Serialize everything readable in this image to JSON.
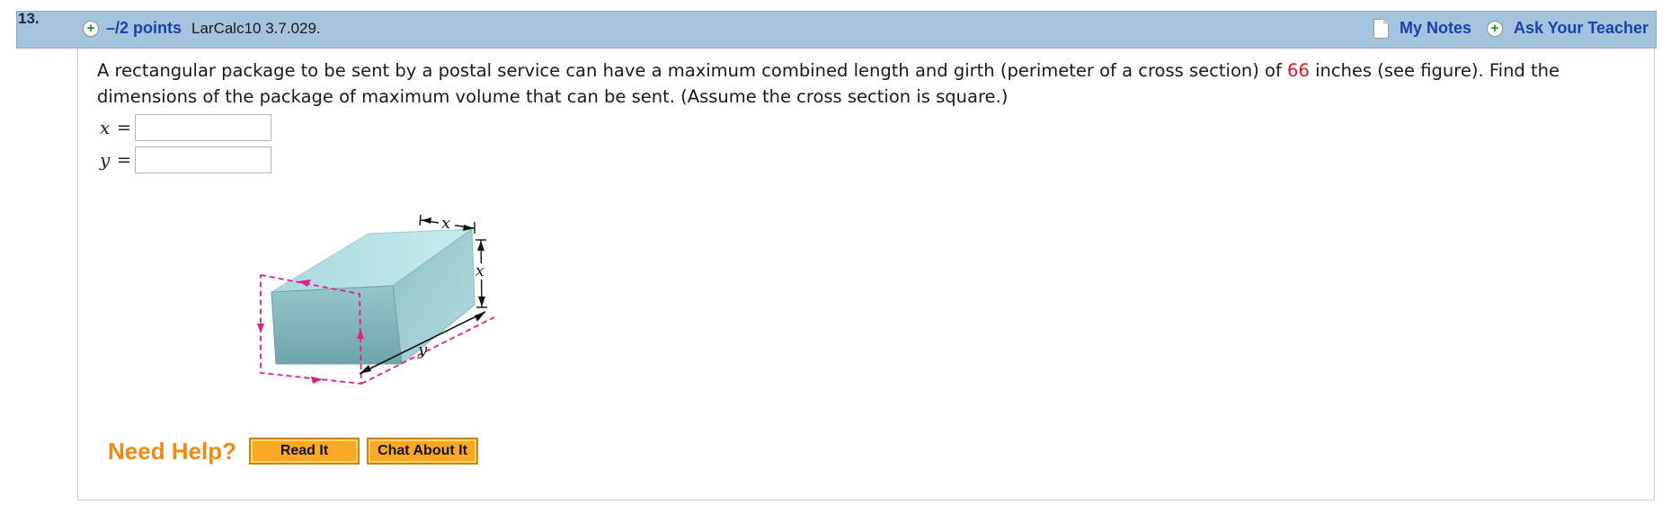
{
  "header": {
    "question_number": "13.",
    "points": "–/2 points",
    "reference": "LarCalc10 3.7.029.",
    "my_notes": "My Notes",
    "ask_teacher": "Ask Your Teacher",
    "icons": [
      "plus-circle-icon",
      "note-icon"
    ]
  },
  "question": {
    "text_before": "A rectangular package to be sent by a postal service can have a maximum combined length and girth (perimeter of a cross section) of ",
    "value": "66",
    "text_after": " inches (see figure). Find the dimensions of the package of maximum volume that can be sent. (Assume the cross section is square.)"
  },
  "answers": [
    {
      "var": "x",
      "equals": "=",
      "value": ""
    },
    {
      "var": "y",
      "equals": "=",
      "value": ""
    }
  ],
  "figure": {
    "label_x_top": "x",
    "label_x_side": "x",
    "label_y": "y"
  },
  "help": {
    "label": "Need Help?",
    "read_it": "Read It",
    "chat": "Chat About It"
  },
  "colors": {
    "header_bg": "#a4c4de",
    "link": "#1e3fae",
    "value_highlight": "#e8141e",
    "help_orange": "#f08a12",
    "button_bg": "#f9a825",
    "box_face": "#8fbfc4",
    "dashed_magenta": "#e0208a"
  }
}
